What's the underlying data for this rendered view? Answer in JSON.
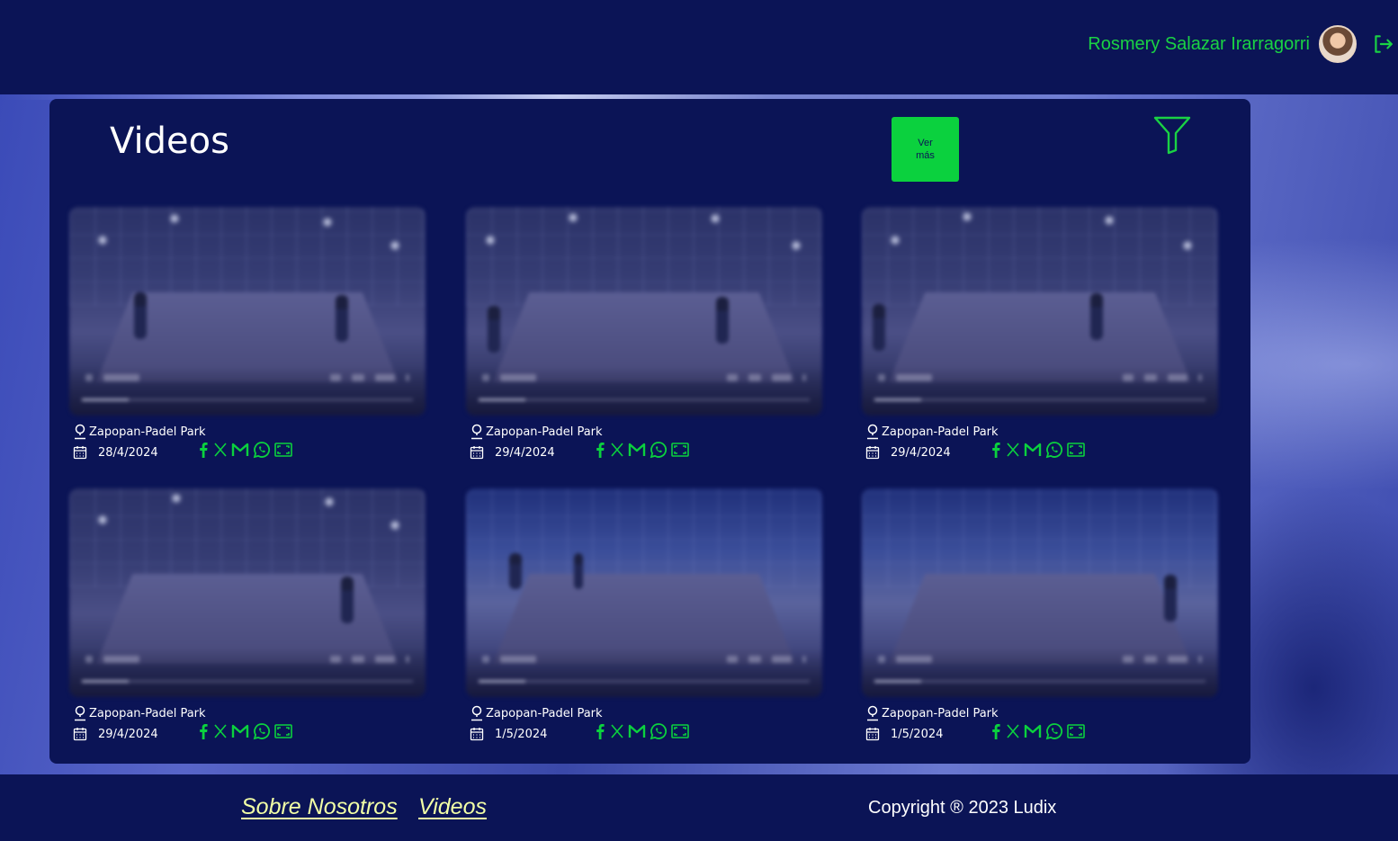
{
  "user": {
    "name": "Rosmery Salazar Irarragorri"
  },
  "page": {
    "title": "Videos",
    "ver_mas_label": "Ver\nmás"
  },
  "colors": {
    "accent": "#0bd13e",
    "background": "#0b1456",
    "footer_link": "#f2ffa6"
  },
  "icons": [
    "logout-icon",
    "filter-icon",
    "location-pin-icon",
    "calendar-icon",
    "facebook-icon",
    "x-icon",
    "gmail-icon",
    "whatsapp-icon",
    "fullscreen-icon"
  ],
  "videos": [
    {
      "location": "Zapopan-Padel Park",
      "date": "28/4/2024"
    },
    {
      "location": "Zapopan-Padel Park",
      "date": "29/4/2024"
    },
    {
      "location": "Zapopan-Padel Park",
      "date": "29/4/2024"
    },
    {
      "location": "Zapopan-Padel Park",
      "date": "29/4/2024"
    },
    {
      "location": "Zapopan-Padel Park",
      "date": "1/5/2024"
    },
    {
      "location": "Zapopan-Padel Park",
      "date": "1/5/2024"
    }
  ],
  "footer": {
    "links": [
      "Sobre Nosotros",
      "Videos"
    ],
    "copyright": "Copyright ® 2023 Ludix"
  }
}
